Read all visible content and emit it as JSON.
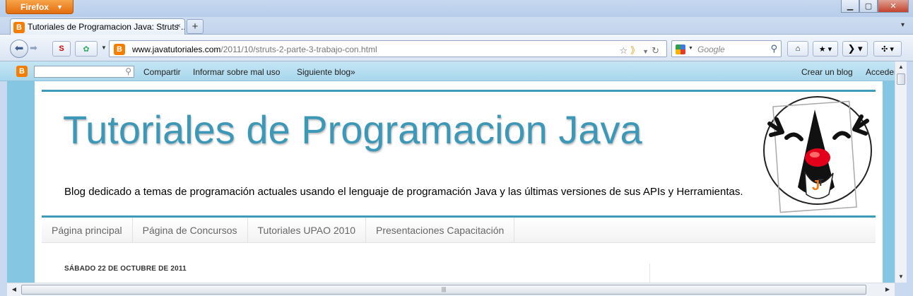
{
  "window": {
    "firefox_label": "Firefox",
    "tab_title": "Tutoriales de Programacion Java: Struts ...",
    "tab_close": "×",
    "new_tab": "+",
    "tab_list": "▾"
  },
  "nav": {
    "url_domain": "www.javatutoriales.com",
    "url_path": "/2011/10/struts-2-parte-3-trabajo-con.html",
    "search_placeholder": "Google"
  },
  "bloggerbar": {
    "links": [
      "Compartir",
      "Informar sobre mal uso",
      "Siguiente blog»"
    ],
    "right_links": [
      "Crear un blog",
      "Acceder"
    ]
  },
  "blog": {
    "title": "Tutoriales de Programacion Java",
    "description": "Blog dedicado a temas de programación actuales usando el lenguaje de programación Java y las últimas versiones de sus APIs y Herramientas.",
    "tabs": [
      "Página principal",
      "Página de Concursos",
      "Tutoriales UPAO 2010",
      "Presentaciones Capacitación"
    ],
    "post_date": "SÁBADO 22 DE OCTUBRE DE 2011",
    "accent_color": "#3d98b8"
  }
}
